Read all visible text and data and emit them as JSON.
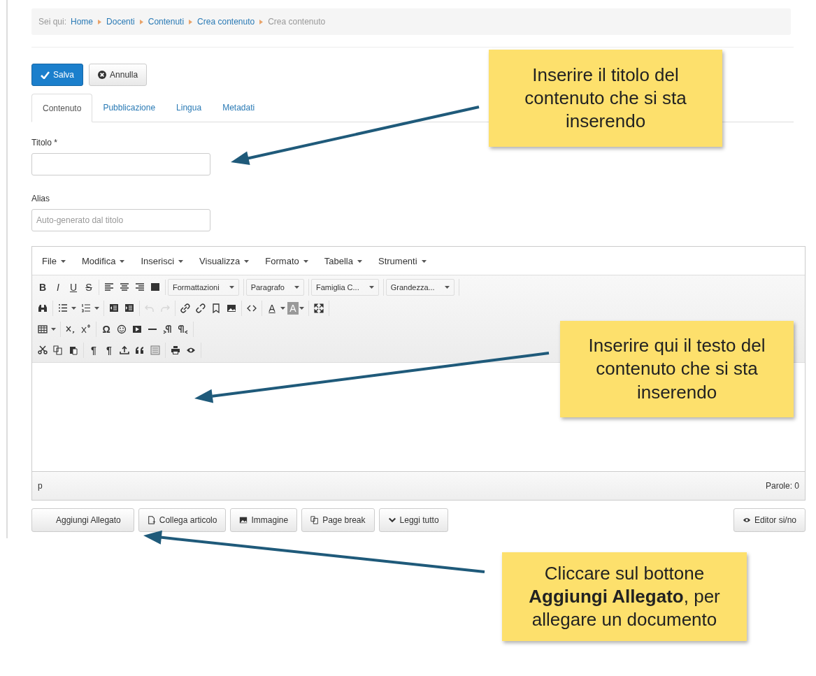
{
  "breadcrumb": {
    "prefix": "Sei qui:",
    "links": [
      "Home",
      "Docenti",
      "Contenuti",
      "Crea contenuto"
    ],
    "current": "Crea contenuto"
  },
  "actions": [
    {
      "kind": "save",
      "label": "Salva"
    },
    {
      "kind": "cancel",
      "label": "Annulla"
    }
  ],
  "tabs": [
    {
      "label": "Contenuto",
      "selected": true
    },
    {
      "label": "Pubblicazione",
      "selected": false
    },
    {
      "label": "Lingua",
      "selected": false
    },
    {
      "label": "Metadati",
      "selected": false
    }
  ],
  "fields": [
    {
      "label": "Titolo *"
    },
    {
      "label": "Alias",
      "placeholder": "Auto-generato dal titolo"
    }
  ],
  "editor": {
    "menu": [
      "File",
      "Modifica",
      "Inserisci",
      "Visualizza",
      "Formato",
      "Tabella",
      "Strumenti"
    ],
    "toolbar": [
      [
        [
          {
            "kind": "bold",
            "text": "B"
          },
          {
            "kind": "italic",
            "text": "I"
          },
          {
            "kind": "underline",
            "text": "U"
          },
          {
            "kind": "strike",
            "text": "S"
          }
        ],
        [
          {
            "kind": "alignleft"
          },
          {
            "kind": "aligncenter"
          },
          {
            "kind": "alignright"
          },
          {
            "kind": "justify"
          }
        ],
        [
          {
            "kind": "select",
            "label": "Formattazioni"
          }
        ],
        [
          {
            "kind": "select",
            "label": "Paragrafo"
          }
        ],
        [
          {
            "kind": "select",
            "label": "Famiglia C..."
          }
        ],
        [
          {
            "kind": "select",
            "label": "Grandezza..."
          }
        ]
      ],
      [
        [
          {
            "kind": "binoculars"
          }
        ],
        [
          {
            "kind": "bullets",
            "caret": true
          },
          {
            "kind": "numbers",
            "caret": true
          }
        ],
        [
          {
            "kind": "outdent"
          },
          {
            "kind": "indent"
          }
        ],
        [
          {
            "kind": "undo",
            "disabled": true
          },
          {
            "kind": "redo",
            "disabled": true
          }
        ],
        [
          {
            "kind": "link"
          },
          {
            "kind": "unlink"
          },
          {
            "kind": "bookmark"
          },
          {
            "kind": "image"
          }
        ],
        [
          {
            "kind": "code"
          }
        ],
        [
          {
            "kind": "forecolor",
            "text": "A",
            "caret": true
          },
          {
            "kind": "backcolor",
            "text": "A",
            "caret": true
          }
        ],
        [
          {
            "kind": "fullscreen"
          }
        ]
      ],
      [
        [
          {
            "kind": "table",
            "caret": true
          }
        ],
        [
          {
            "kind": "subscript"
          },
          {
            "kind": "superscript"
          }
        ],
        [
          {
            "kind": "letter",
            "text": "Ω"
          },
          {
            "kind": "emoji"
          },
          {
            "kind": "media"
          },
          {
            "kind": "hr"
          },
          {
            "kind": "ltr"
          },
          {
            "kind": "rtl"
          }
        ]
      ],
      [
        [
          {
            "kind": "cut"
          },
          {
            "kind": "copy"
          },
          {
            "kind": "paste"
          }
        ],
        [
          {
            "kind": "letter",
            "text": "¶"
          },
          {
            "kind": "letter",
            "text": "¶"
          },
          {
            "kind": "upload"
          },
          {
            "kind": "quote"
          },
          {
            "kind": "template"
          }
        ],
        [
          {
            "kind": "print"
          },
          {
            "kind": "preview"
          }
        ]
      ]
    ],
    "path": "p",
    "word_count": "Parole: 0"
  },
  "editor_buttons": [
    {
      "kind": "none",
      "label": "Aggiungi Allegato"
    },
    {
      "kind": "file",
      "label": "Collega articolo"
    },
    {
      "kind": "image",
      "label": "Immagine"
    },
    {
      "kind": "copy",
      "label": "Page break"
    },
    {
      "kind": "chevron",
      "label": "Leggi tutto"
    },
    {
      "kind": "eye",
      "label": "Editor si/no"
    }
  ],
  "callouts": [
    {
      "text": "Inserire il titolo del contenuto che si sta inserendo"
    },
    {
      "text": "Inserire qui il testo del contenuto che si sta inserendo"
    },
    {
      "text": "Cliccare sul bottone **Aggiungi Allegato**, per allegare un documento"
    }
  ]
}
